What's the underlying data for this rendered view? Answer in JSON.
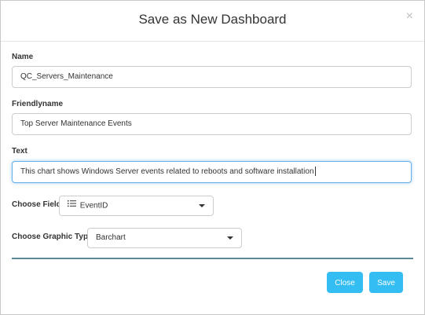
{
  "dialog": {
    "title": "Save as New Dashboard",
    "close_symbol": "×"
  },
  "fields": {
    "name": {
      "label": "Name",
      "value": "QC_Servers_Maintenance"
    },
    "friendlyname": {
      "label": "Friendlyname",
      "value": "Top Server Maintenance Events"
    },
    "text": {
      "label": "Text",
      "value": "This chart shows Windows Server events related to reboots and software installation"
    },
    "choose_field": {
      "label": "Choose Field",
      "selected": "EventID",
      "icon": "list-icon"
    },
    "choose_graphic_type": {
      "label": "Choose Graphic Type",
      "selected": "Barchart"
    }
  },
  "buttons": {
    "close_label": "Close",
    "save_label": "Save"
  },
  "colors": {
    "button": "#33bdf2",
    "divider": "#5b8a96",
    "focus": "#66afe9"
  }
}
